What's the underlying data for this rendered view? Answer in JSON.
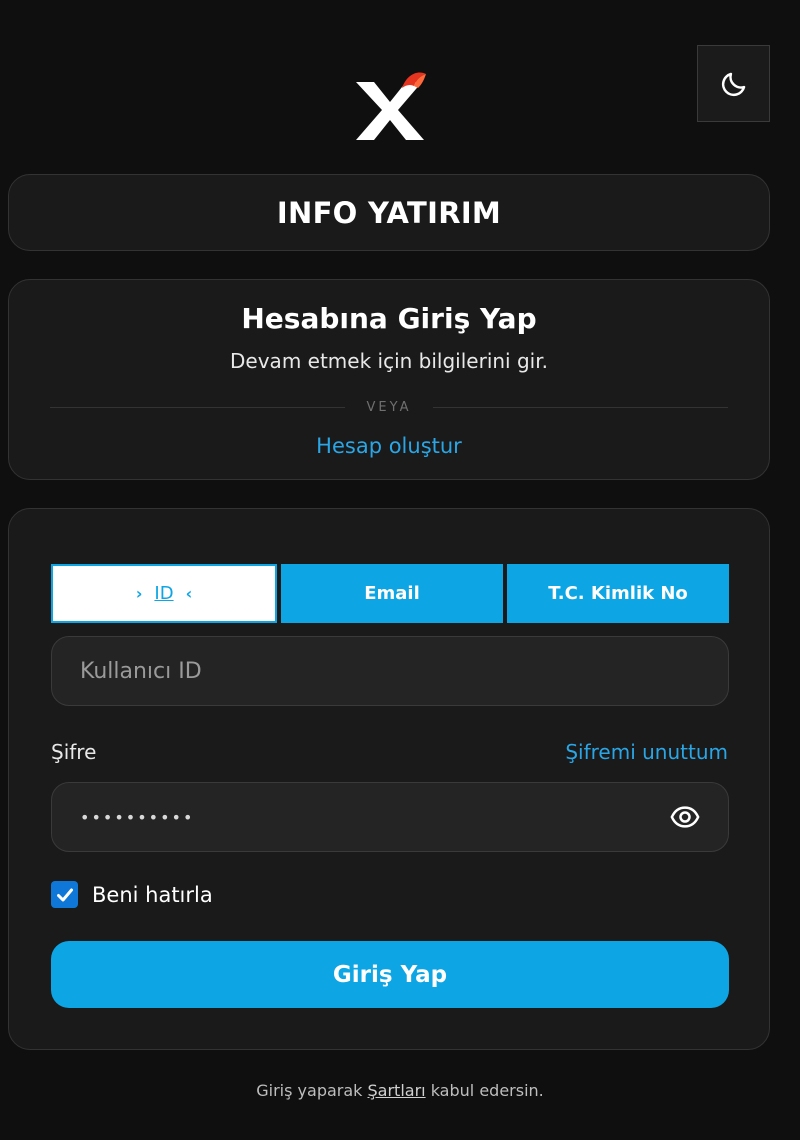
{
  "brand": {
    "name": "INFO YATIRIM"
  },
  "intro": {
    "title": "Hesabına Giriş Yap",
    "subtitle": "Devam etmek için bilgilerini gir.",
    "divider": "VEYA",
    "create_account": "Hesap oluştur"
  },
  "tabs": [
    {
      "label": "ID",
      "active": true
    },
    {
      "label": "Email",
      "active": false
    },
    {
      "label": "T.C. Kimlik No",
      "active": false
    }
  ],
  "tab_arrows": {
    "left": "›",
    "right": "‹"
  },
  "id_field": {
    "placeholder": "Kullanıcı ID"
  },
  "password": {
    "label": "Şifre",
    "forgot": "Şifremi unuttum",
    "masked_value": "••••••••••"
  },
  "remember": {
    "label": "Beni hatırla",
    "checked": true
  },
  "submit": {
    "label": "Giriş Yap"
  },
  "footer": {
    "prefix": "Giriş yaparak ",
    "link": "Şartları",
    "suffix": " kabul edersin."
  },
  "colors": {
    "accent": "#0ea5e4",
    "link": "#2aa6e6",
    "background": "#0f0f0f",
    "card": "#1a1a1a"
  },
  "icons": {
    "theme_toggle": "moon-icon",
    "logo": "x-logo-icon",
    "password_visibility": "eye-icon",
    "remember": "check-icon"
  }
}
